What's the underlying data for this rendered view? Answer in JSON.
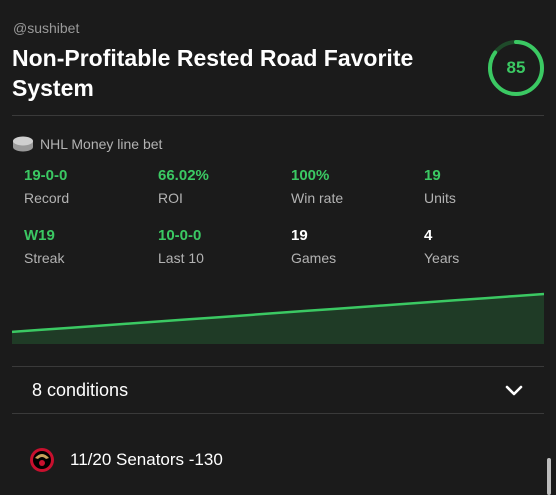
{
  "header": {
    "handle": "@sushibet",
    "title": "Non-Profitable Rested Road Favorite System",
    "score": "85",
    "score_fraction": 0.85
  },
  "bet_type": {
    "label": "NHL Money line bet",
    "icon": "hockey-puck-icon"
  },
  "stats": [
    {
      "value": "19-0-0",
      "label": "Record",
      "color": "green"
    },
    {
      "value": "66.02%",
      "label": "ROI",
      "color": "green"
    },
    {
      "value": "100%",
      "label": "Win rate",
      "color": "green"
    },
    {
      "value": "19",
      "label": "Units",
      "color": "green"
    },
    {
      "value": "W19",
      "label": "Streak",
      "color": "green"
    },
    {
      "value": "10-0-0",
      "label": "Last 10",
      "color": "green"
    },
    {
      "value": "19",
      "label": "Games",
      "color": "white"
    },
    {
      "value": "4",
      "label": "Years",
      "color": "white"
    }
  ],
  "chart_data": {
    "type": "area",
    "series": [
      {
        "values": [
          1,
          2,
          3,
          4,
          5,
          6,
          7,
          8,
          9,
          10,
          11,
          12,
          13,
          14,
          15,
          16,
          17,
          18,
          19
        ]
      }
    ],
    "color": "#3bc963"
  },
  "conditions": {
    "label": "8 conditions",
    "icon": "chevron-down-icon"
  },
  "game": {
    "team_logo": "senators-logo",
    "text": "11/20 Senators -130"
  },
  "colors": {
    "accent": "#3bc963",
    "background": "#1b1b1b",
    "muted": "#b3b3b3"
  }
}
